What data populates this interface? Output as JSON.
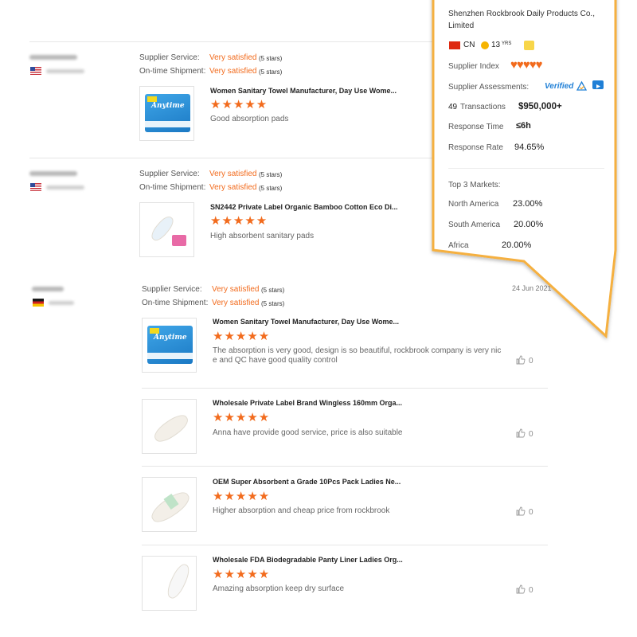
{
  "labels": {
    "supplier_service": "Supplier Service:",
    "ontime_shipment": "On-time Shipment:",
    "very_satisfied": "Very satisfied",
    "five_stars": "(5 stars)"
  },
  "reviewers": [
    {
      "country": "United States",
      "flag": "us"
    },
    {
      "country": "United States",
      "flag": "us"
    },
    {
      "country": "Germany",
      "flag": "de"
    }
  ],
  "reviews": [
    {
      "product": "Women Sanitary Towel Manufacturer, Day Use Wome...",
      "stars": "★★★★★",
      "text": "Good absorption pads"
    },
    {
      "product": "SN2442 Private Label Organic Bamboo Cotton Eco Di...",
      "stars": "★★★★★",
      "text": "High absorbent sanitary pads"
    }
  ],
  "review3": {
    "date": "24 Jun 2021",
    "items": [
      {
        "product": "Women Sanitary Towel Manufacturer, Day Use Wome...",
        "stars": "★★★★★",
        "text_line1": "The absorption is very good, design is so beautiful, rockbrook company is very nic",
        "text_line2": "e and QC have good quality control",
        "likes": "0"
      },
      {
        "product": "Wholesale Private Label Brand Wingless 160mm Orga...",
        "stars": "★★★★★",
        "text_line1": "Anna have provide good service, price is also suitable",
        "likes": "0"
      },
      {
        "product": "OEM Super Absorbent a Grade 10Pcs Pack Ladies Ne...",
        "stars": "★★★★★",
        "text_line1": "Higher absorption and cheap price from rockbrook",
        "likes": "0"
      },
      {
        "product": "Wholesale FDA Biodegradable Panty Liner Ladies Org...",
        "stars": "★★★★★",
        "text_line1": "Amazing absorption keep dry surface",
        "likes": "0"
      }
    ]
  },
  "product_image": {
    "brand": "Anytime"
  },
  "supplier": {
    "name_line1": "Shenzhen Rockbrook Daily Products Co.,",
    "name_line2": "Limited",
    "country": "CN",
    "years": "13",
    "years_suffix": "YRS",
    "index_label": "Supplier Index",
    "index_hearts": "♥♥♥♥♥",
    "assess_label": "Supplier Assessments:",
    "verified": "Verified",
    "transactions_count": "49",
    "transactions_label": "Transactions",
    "transactions_value": "$950,000+",
    "response_time_label": "Response Time",
    "response_time_value": "≤6h",
    "response_rate_label": "Response Rate",
    "response_rate_value": "94.65%",
    "markets_title": "Top 3 Markets:",
    "markets": [
      {
        "name": "North America",
        "value": "23.00%"
      },
      {
        "name": "South America",
        "value": "20.00%"
      },
      {
        "name": "Africa",
        "value": "20.00%"
      }
    ]
  },
  "colors": {
    "accent": "#f26b1d",
    "verified": "#1f7fd6",
    "popover_border": "#f5b041"
  }
}
